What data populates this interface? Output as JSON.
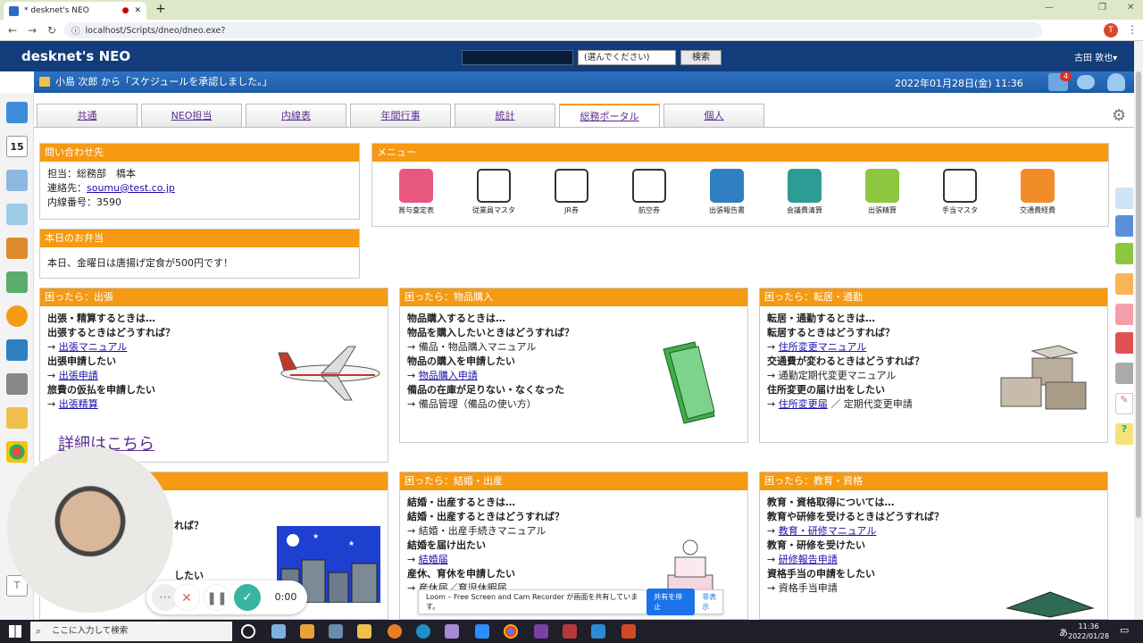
{
  "browser": {
    "tab_title": "* desknet's NEO",
    "url": "localhost/Scripts/dneo/dneo.exe?"
  },
  "header": {
    "logo": "desknet's NEO",
    "select_value": "(選んでください)",
    "search_button": "検索",
    "user": "古田 敦也▾",
    "notification_count": "4"
  },
  "notice": {
    "text": "小島 次郎 から「スケジュールを承認しました。」",
    "datetime": "2022年01月28日(金) 11:36"
  },
  "sidebar": {
    "calendar_day": "15"
  },
  "tabs": [
    "共通",
    "NEO担当",
    "内線表",
    "年間行事",
    "統計",
    "総務ポータル",
    "個人"
  ],
  "contact": {
    "title": "問い合わせ先",
    "person": "担当：総務部　橋本",
    "email_label": "連絡先：",
    "email": "soumu@test.co.jp",
    "ext": "内線番号：3590"
  },
  "lunch": {
    "title": "本日のお弁当",
    "text": "本日、金曜日は唐揚げ定食が500円です！"
  },
  "menu": {
    "title": "メニュー",
    "items": [
      "賞与査定表",
      "従業員マスタ",
      "JR券",
      "航空券",
      "出張報告書",
      "会議費清算",
      "出張精算",
      "手当マスタ",
      "交通費経費"
    ],
    "colors": [
      "#e8577e",
      "#ffffff",
      "#ffffff",
      "#ffffff",
      "#2f7fc1",
      "#2d9c94",
      "#8dc63f",
      "#ffffff",
      "#f28c28"
    ]
  },
  "trip": {
    "title": "困ったら：出張",
    "l1": "出張・精算するときは…",
    "l2": "出張するときはどうすれば？",
    "l3_arrow": "→ ",
    "l3_link": "出張マニュアル",
    "l4": "出張申請したい",
    "l5_link": "出張申請",
    "l6": "旅費の仮払を申請したい",
    "l7_link": "出張精算",
    "more": "詳細はこちら"
  },
  "purchase": {
    "title": "困ったら：物品購入",
    "l1": "物品購入するときは…",
    "l2": "物品を購入したいときはどうすれば？",
    "l3": "→ 備品・物品購入マニュアル",
    "l4": "物品の購入を申請したい",
    "l5_link": "物品購入申請",
    "l6": "備品の在庫が足りない・なくなった",
    "l7": "→ 備品管理（備品の使い方）"
  },
  "moving": {
    "title": "困ったら：転居・通勤",
    "l1": "転居・通勤するときは…",
    "l2": "転居するときはどうすれば？",
    "l3_link": "住所変更マニュアル",
    "l4": "交通費が変わるときはどうすれば？",
    "l5": "→ 通勤定期代変更マニュアル",
    "l6": "住所変更の届け出をしたい",
    "l7_link": "住所変更届",
    "l7_rest": "／ 定期代変更申請"
  },
  "bottom_left": {
    "l1": "れば？",
    "l2": "したい"
  },
  "marriage": {
    "title": "困ったら：結婚・出産",
    "l1": "結婚・出産するときは…",
    "l2": "結婚・出産するときはどうすれば？",
    "l3": "→ 結婚・出産手続きマニュアル",
    "l4": "結婚を届け出たい",
    "l5_link": "結婚届",
    "l6": "産休、育休を申請したい",
    "l7": "→ 産休届／育児休暇届"
  },
  "education": {
    "title": "困ったら：教育・資格",
    "l1": "教育・資格取得については…",
    "l2": "教育や研修を受けるときはどうすれば？",
    "l3_link": "教育・研修マニュアル",
    "l4": "教育・研修を受けたい",
    "l5_link": "研修報告申請",
    "l6": "資格手当の申請をしたい",
    "l7": "→ 資格手当申請"
  },
  "loom": {
    "timer": "0:00",
    "share_text": "Loom – Free Screen and Cam Recorder が画面を共有しています。",
    "stop": "共有を停止",
    "hide": "非表示"
  },
  "taskbar": {
    "search": "ここに入力して検索",
    "time": "11:36",
    "date": "2022/01/28",
    "ime": "あ"
  }
}
